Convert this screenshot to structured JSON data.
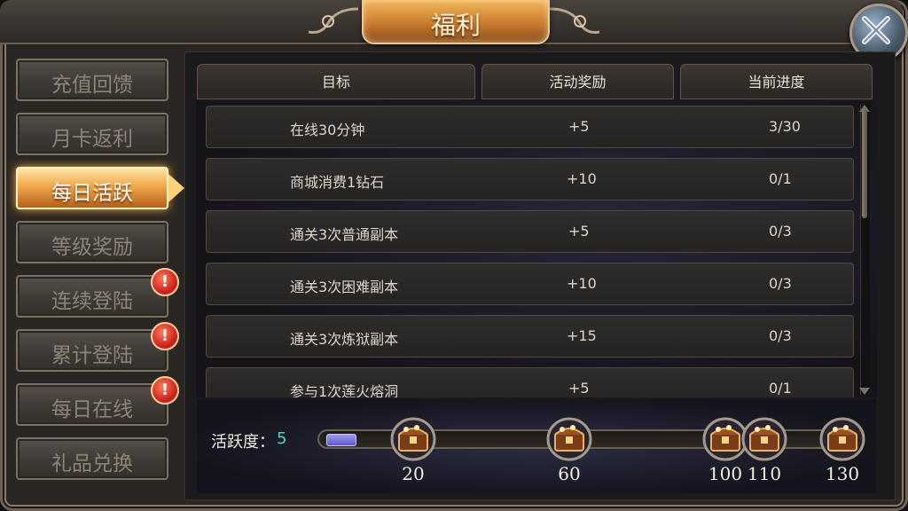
{
  "title": "福利",
  "sidebar": {
    "items": [
      {
        "label": "充值回馈",
        "active": false,
        "alert": false
      },
      {
        "label": "月卡返利",
        "active": false,
        "alert": false
      },
      {
        "label": "每日活跃",
        "active": true,
        "alert": false
      },
      {
        "label": "等级奖励",
        "active": false,
        "alert": false
      },
      {
        "label": "连续登陆",
        "active": false,
        "alert": true
      },
      {
        "label": "累计登陆",
        "active": false,
        "alert": true
      },
      {
        "label": "每日在线",
        "active": false,
        "alert": true
      },
      {
        "label": "礼品兑换",
        "active": false,
        "alert": false
      }
    ],
    "alert_mark": "!"
  },
  "table": {
    "headers": [
      "目标",
      "活动奖励",
      "当前进度"
    ],
    "rows": [
      {
        "goal": "在线30分钟",
        "reward": "+5",
        "progress": "3/30"
      },
      {
        "goal": "商城消费1钻石",
        "reward": "+10",
        "progress": "0/1"
      },
      {
        "goal": "通关3次普通副本",
        "reward": "+5",
        "progress": "0/3"
      },
      {
        "goal": "通关3次困难副本",
        "reward": "+10",
        "progress": "0/3"
      },
      {
        "goal": "通关3次炼狱副本",
        "reward": "+15",
        "progress": "0/3"
      },
      {
        "goal": "参与1次莲火熔洞",
        "reward": "+5",
        "progress": "0/1"
      }
    ]
  },
  "activity": {
    "label": "活跃度：",
    "value": "5",
    "current": 5,
    "max": 130,
    "milestones": [
      {
        "value": 20,
        "label": "20"
      },
      {
        "value": 60,
        "label": "60"
      },
      {
        "value": 100,
        "label": "100"
      },
      {
        "value": 110,
        "label": "110"
      },
      {
        "value": 130,
        "label": "130"
      }
    ]
  },
  "icons": {
    "close": "close-icon",
    "chest": "treasure-chest-icon",
    "alert": "exclamation-icon"
  },
  "colors": {
    "accent": "#f0a84a",
    "activity_value": "#55d1c8",
    "alert": "#c8201a"
  }
}
